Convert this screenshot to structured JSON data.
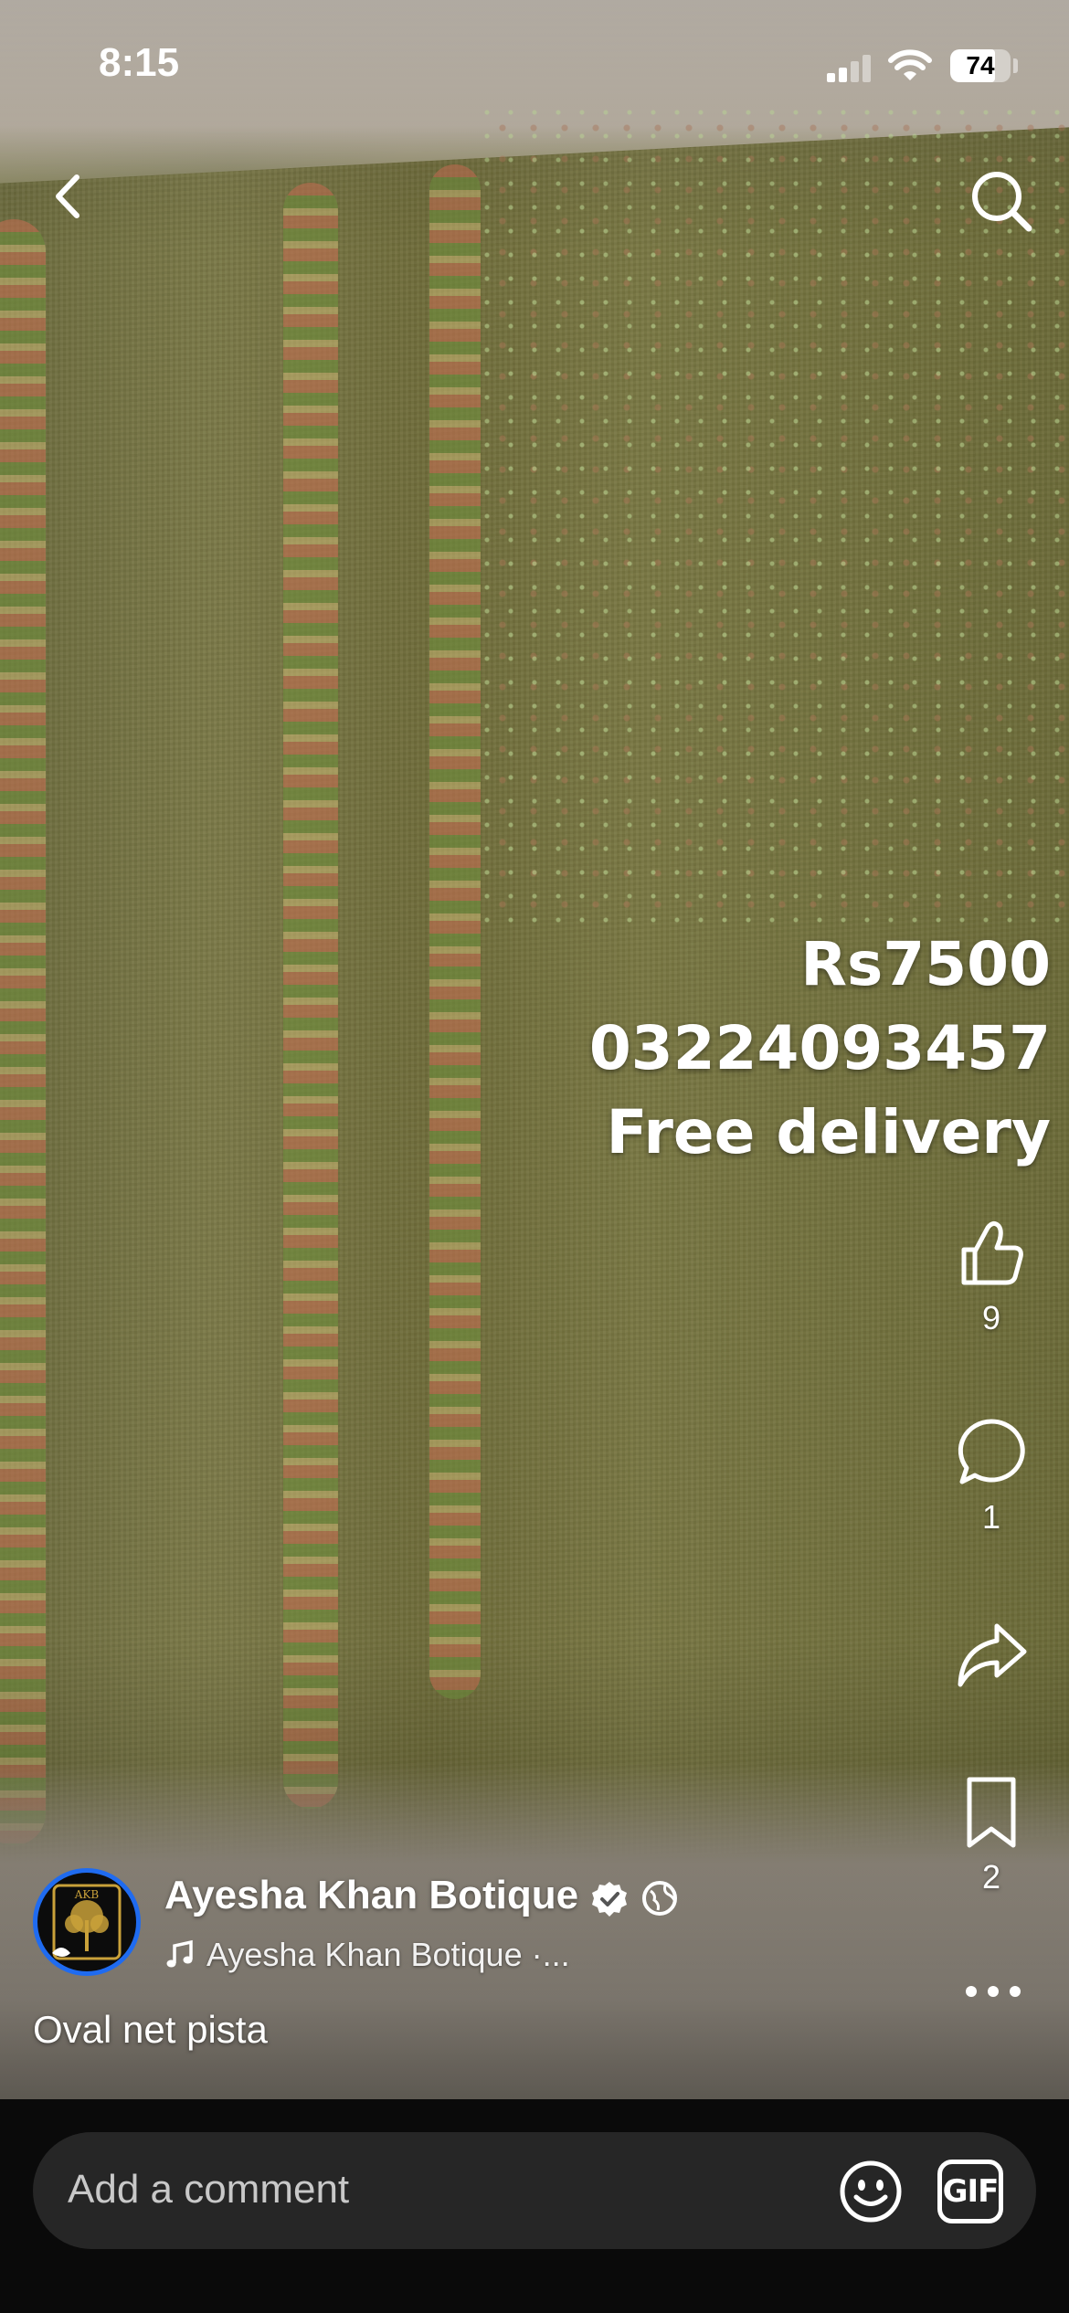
{
  "status_bar": {
    "time": "8:15",
    "battery": "74",
    "battery_level": 0.74
  },
  "video": {
    "overlay_lines": [
      "Rs7500",
      "03224093457",
      "Free delivery"
    ]
  },
  "actions": {
    "like_count": "9",
    "comment_count": "1",
    "share_count": "",
    "save_count": "2"
  },
  "author": {
    "name": "Ayesha Khan Botique",
    "avatar_text": "AKB",
    "music": "Ayesha Khan Botique ·..."
  },
  "caption": "Oval net pista",
  "comment_bar": {
    "placeholder": "Add a comment",
    "gif_label": "GIF"
  },
  "icons": {
    "back": "chevron-left-icon",
    "search": "search-icon",
    "like": "thumbs-up-icon",
    "comment": "comment-bubble-icon",
    "share": "share-arrow-icon",
    "save": "bookmark-icon",
    "more": "more-dots-icon",
    "verified": "verified-badge-icon",
    "globe": "globe-icon",
    "music": "music-note-icon",
    "emoji": "emoji-icon"
  },
  "colors": {
    "verified_accent": "#1f6bf0",
    "comment_bar_bg": "#0a0a0a",
    "comment_pill_bg": "#262626"
  }
}
